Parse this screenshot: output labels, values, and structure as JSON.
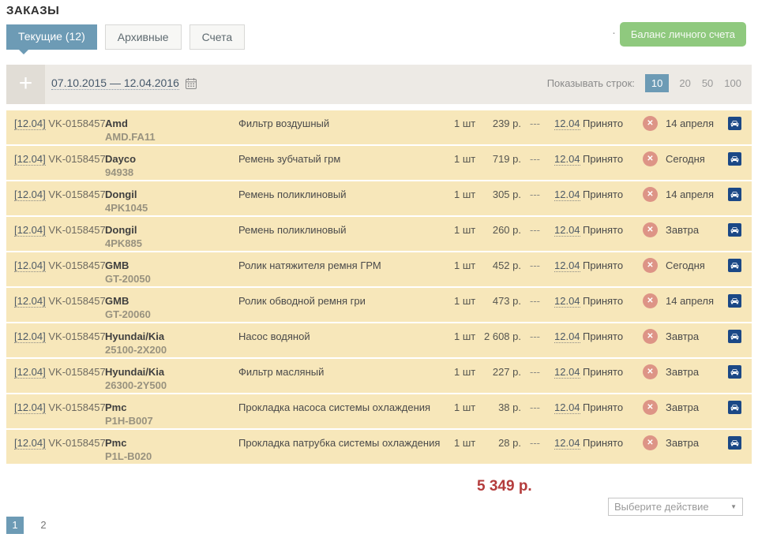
{
  "page": {
    "title": "ЗАКАЗЫ"
  },
  "tabs": {
    "current": "Текущие (12)",
    "archive": "Архивные",
    "invoices": "Счета"
  },
  "balance_button_label": "Баланс личного счета",
  "toolbar": {
    "add_label": "+",
    "date_range": "07.10.2015 — 12.04.2016",
    "rows_label": "Показывать строк:",
    "rows_options": [
      "10",
      "20",
      "50",
      "100"
    ],
    "rows_selected": "10"
  },
  "icons": {
    "add": "plus-icon",
    "calendar": "calendar-icon",
    "cancel": "x-circle-icon",
    "delivery": "car-icon",
    "dropdown": "chevron-down-icon"
  },
  "colors": {
    "accent_blue": "#6d9bb5",
    "row_beige": "#f7e7ba",
    "button_green": "#8fc97e",
    "total_red": "#b43c3c",
    "car_navy": "#1b4886",
    "cancel_salmon": "#dd9486"
  },
  "table": {
    "rows": [
      {
        "date_link": "[12.04]",
        "order": "VK-0158457",
        "brand": "Amd",
        "part": "AMD.FA11",
        "desc": "Фильтр воздушный",
        "qty": "1 шт",
        "price": "239 р.",
        "dash": "---",
        "ship_date": "12.04",
        "status": "Принято",
        "cancel": "✕",
        "delivery": "14 апреля"
      },
      {
        "date_link": "[12.04]",
        "order": "VK-0158457",
        "brand": "Dayco",
        "part": "94938",
        "desc": "Ремень зубчатый грм",
        "qty": "1 шт",
        "price": "719 р.",
        "dash": "---",
        "ship_date": "12.04",
        "status": "Принято",
        "cancel": "✕",
        "delivery": "Сегодня"
      },
      {
        "date_link": "[12.04]",
        "order": "VK-0158457",
        "brand": "Dongil",
        "part": "4PK1045",
        "desc": "Ремень поликлиновый",
        "qty": "1 шт",
        "price": "305 р.",
        "dash": "---",
        "ship_date": "12.04",
        "status": "Принято",
        "cancel": "✕",
        "delivery": "14 апреля"
      },
      {
        "date_link": "[12.04]",
        "order": "VK-0158457",
        "brand": "Dongil",
        "part": "4PK885",
        "desc": "Ремень поликлиновый",
        "qty": "1 шт",
        "price": "260 р.",
        "dash": "---",
        "ship_date": "12.04",
        "status": "Принято",
        "cancel": "✕",
        "delivery": "Завтра"
      },
      {
        "date_link": "[12.04]",
        "order": "VK-0158457",
        "brand": "GMB",
        "part": "GT-20050",
        "desc": "Ролик натяжителя ремня ГРМ",
        "qty": "1 шт",
        "price": "452 р.",
        "dash": "---",
        "ship_date": "12.04",
        "status": "Принято",
        "cancel": "✕",
        "delivery": "Сегодня"
      },
      {
        "date_link": "[12.04]",
        "order": "VK-0158457",
        "brand": "GMB",
        "part": "GT-20060",
        "desc": "Ролик обводной ремня гри",
        "qty": "1 шт",
        "price": "473 р.",
        "dash": "---",
        "ship_date": "12.04",
        "status": "Принято",
        "cancel": "✕",
        "delivery": "14 апреля"
      },
      {
        "date_link": "[12.04]",
        "order": "VK-0158457",
        "brand": "Hyundai/Kia",
        "part": "25100-2X200",
        "desc": "Насос водяной",
        "qty": "1 шт",
        "price": "2 608 р.",
        "dash": "---",
        "ship_date": "12.04",
        "status": "Принято",
        "cancel": "✕",
        "delivery": "Завтра"
      },
      {
        "date_link": "[12.04]",
        "order": "VK-0158457",
        "brand": "Hyundai/Kia",
        "part": "26300-2Y500",
        "desc": "Фильтр масляный",
        "qty": "1 шт",
        "price": "227 р.",
        "dash": "---",
        "ship_date": "12.04",
        "status": "Принято",
        "cancel": "✕",
        "delivery": "Завтра"
      },
      {
        "date_link": "[12.04]",
        "order": "VK-0158457",
        "brand": "Pmc",
        "part": "P1H-B007",
        "desc": "Прокладка насоса системы охлаждения",
        "qty": "1 шт",
        "price": "38 р.",
        "dash": "---",
        "ship_date": "12.04",
        "status": "Принято",
        "cancel": "✕",
        "delivery": "Завтра"
      },
      {
        "date_link": "[12.04]",
        "order": "VK-0158457",
        "brand": "Pmc",
        "part": "P1L-B020",
        "desc": "Прокладка патрубка системы охлаждения",
        "qty": "1 шт",
        "price": "28 р.",
        "dash": "---",
        "ship_date": "12.04",
        "status": "Принято",
        "cancel": "✕",
        "delivery": "Завтра"
      }
    ]
  },
  "footer": {
    "total": "5 349 р.",
    "action_select_label": "Выберите действие",
    "pages": [
      "1",
      "2"
    ],
    "active_page": "1"
  }
}
